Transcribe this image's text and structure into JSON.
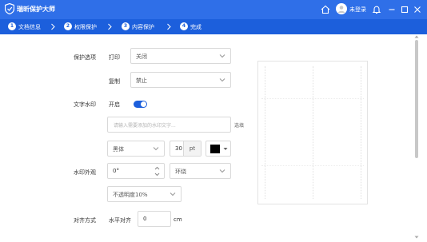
{
  "app": {
    "title": "瑞昕保护大师"
  },
  "titlebar": {
    "login_text": "未登录"
  },
  "steps": [
    {
      "num": "1",
      "label": "文档信息"
    },
    {
      "num": "2",
      "label": "权限保护"
    },
    {
      "num": "3",
      "label": "内容保护"
    },
    {
      "num": "4",
      "label": "完成"
    }
  ],
  "protect_options": {
    "section_label": "保护选项",
    "print": {
      "label": "打印",
      "value": "关闭"
    },
    "copy": {
      "label": "复制",
      "value": "禁止"
    }
  },
  "watermark_text": {
    "section_label": "文字水印",
    "enable_label": "开启",
    "enabled": true,
    "placeholder": "请输入需要添加的水印文字...",
    "select_link": "选填",
    "font": "黑体",
    "size": "30",
    "size_unit": "pt",
    "color": "#000000"
  },
  "watermark_appearance": {
    "section_label": "水印外观",
    "rotation": "0°",
    "layout": "环绕",
    "opacity": "不透明度10%"
  },
  "alignment": {
    "section_label": "对齐方式",
    "horizontal_label": "水平对齐",
    "horizontal_value": "0",
    "unit": "cm"
  },
  "colors": {
    "brand": "#2f6fe8",
    "step_bar": "#1c5fdc"
  }
}
